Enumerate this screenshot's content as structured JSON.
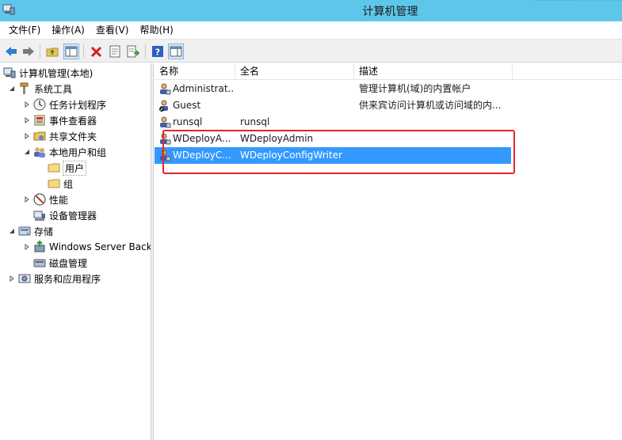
{
  "window": {
    "title": "计算机管理"
  },
  "menu": [
    {
      "label": "文件(F)"
    },
    {
      "label": "操作(A)"
    },
    {
      "label": "查看(V)"
    },
    {
      "label": "帮助(H)"
    }
  ],
  "toolbar": {
    "buttons": [
      {
        "name": "back-icon"
      },
      {
        "name": "forward-icon"
      },
      {
        "name": "up-folder-icon"
      },
      {
        "name": "show-hide-tree-icon"
      },
      {
        "name": "delete-icon"
      },
      {
        "name": "properties-icon"
      },
      {
        "name": "export-list-icon"
      },
      {
        "name": "help-icon"
      },
      {
        "name": "action-pane-icon"
      }
    ]
  },
  "tree": {
    "root": "计算机管理(本地)",
    "system_tools": "系统工具",
    "task_scheduler": "任务计划程序",
    "event_viewer": "事件查看器",
    "shared_folders": "共享文件夹",
    "local_users_groups": "本地用户和组",
    "users": "用户",
    "groups": "组",
    "performance": "性能",
    "device_manager": "设备管理器",
    "storage": "存储",
    "windows_server_backup": "Windows Server Back",
    "disk_management": "磁盘管理",
    "services_apps": "服务和应用程序"
  },
  "list": {
    "columns": [
      "名称",
      "全名",
      "描述"
    ],
    "rows": [
      {
        "name": "Administrat...",
        "fullname": "",
        "description": "管理计算机(域)的内置帐户"
      },
      {
        "name": "Guest",
        "fullname": "",
        "description": "供来宾访问计算机或访问域的内..."
      },
      {
        "name": "runsql",
        "fullname": "runsql",
        "description": ""
      },
      {
        "name": "WDeployA...",
        "fullname": "WDeployAdmin",
        "description": ""
      },
      {
        "name": "WDeployC...",
        "fullname": "WDeployConfigWriter",
        "description": ""
      }
    ],
    "selected_row": 4
  },
  "colors": {
    "titlebar": "#5ec6ea",
    "selection": "#3399ff",
    "highlight": "#e5252a"
  }
}
